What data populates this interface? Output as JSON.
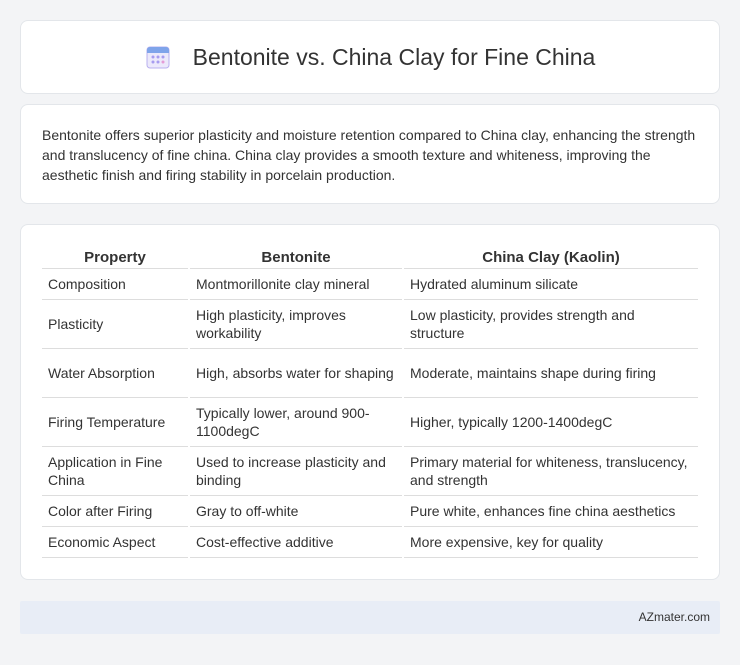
{
  "page": {
    "title": "Bentonite vs. China Clay for Fine China",
    "description": "Bentonite offers superior plasticity and moisture retention compared to China clay, enhancing the strength and translucency of fine china. China clay provides a smooth texture and whiteness, improving the aesthetic finish and firing stability in porcelain production."
  },
  "colors": {
    "background": "#f3f4f6",
    "card": "#ffffff",
    "footer": "#e8edf6",
    "icon_accent": "#8f84e6"
  },
  "table": {
    "headers": [
      "Property",
      "Bentonite",
      "China Clay (Kaolin)"
    ],
    "rows": [
      [
        "Composition",
        "Montmorillonite clay mineral",
        "Hydrated aluminum silicate"
      ],
      [
        "Plasticity",
        "High plasticity, improves workability",
        "Low plasticity, provides strength and structure"
      ],
      [
        "Water Absorption",
        "High, absorbs water for shaping",
        "Moderate, maintains shape during firing"
      ],
      [
        "Firing Temperature",
        "Typically lower, around 900-1100degC",
        "Higher, typically 1200-1400degC"
      ],
      [
        "Application in Fine China",
        "Used to increase plasticity and binding",
        "Primary material for whiteness, translucency, and strength"
      ],
      [
        "Color after Firing",
        "Gray to off-white",
        "Pure white, enhances fine china aesthetics"
      ],
      [
        "Economic Aspect",
        "Cost-effective additive",
        "More expensive, key for quality"
      ]
    ]
  },
  "footer": {
    "brand": "AZmater.com"
  },
  "icons": {
    "title_icon": "calendar-icon"
  }
}
